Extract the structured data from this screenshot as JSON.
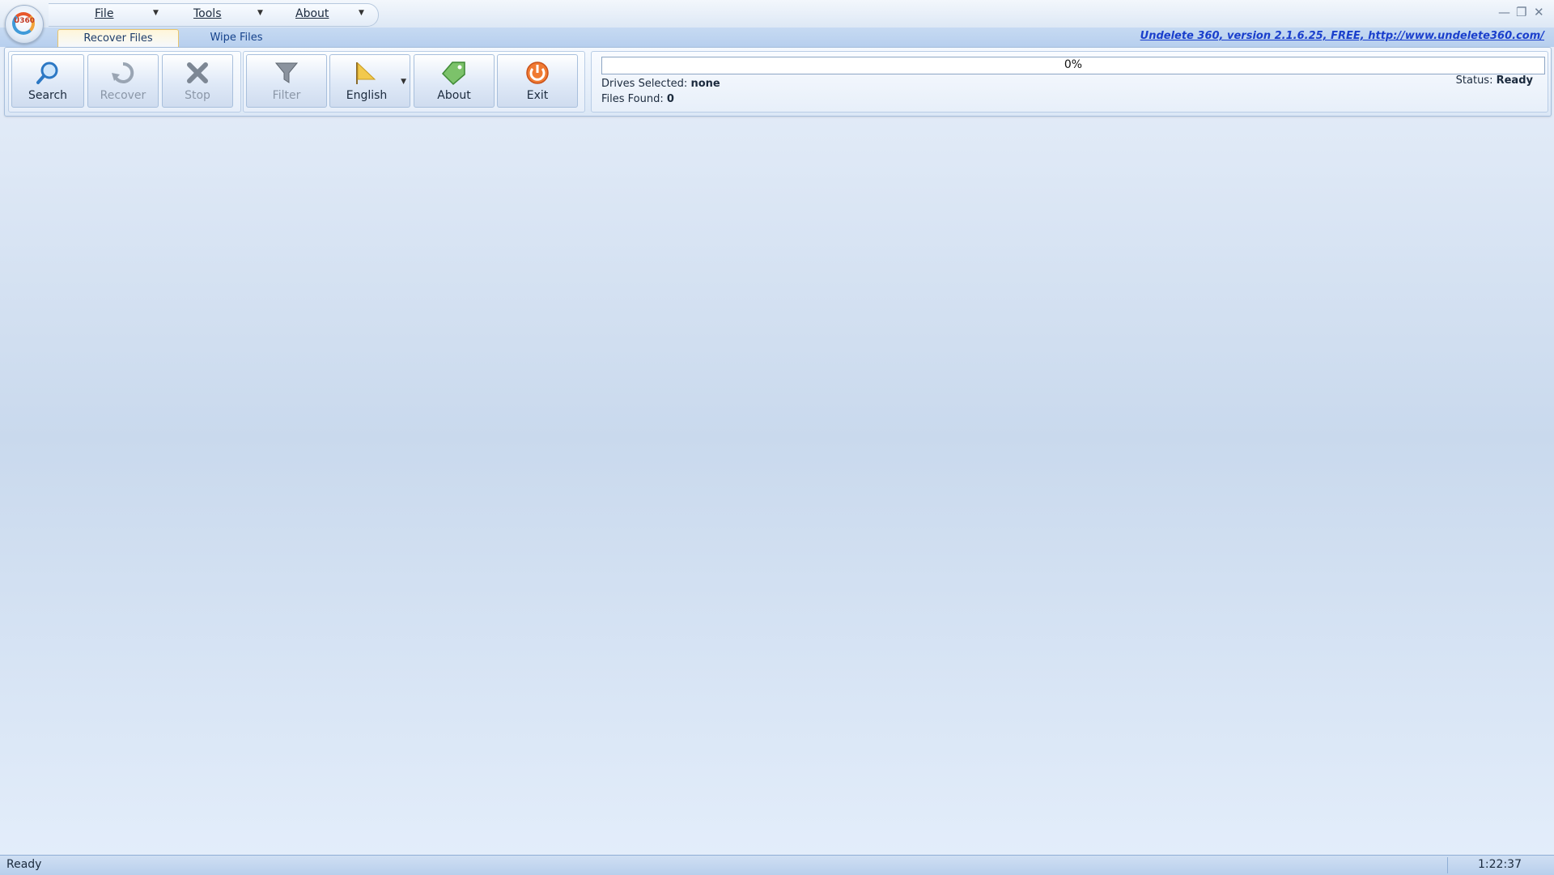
{
  "app": {
    "logo_text": "U360",
    "version_link": "Undelete 360, version 2.1.6.25, FREE, http://www.undelete360.com/"
  },
  "menu": {
    "file": "File",
    "tools": "Tools",
    "about": "About"
  },
  "tabs": [
    {
      "label": "Recover Files",
      "active": true
    },
    {
      "label": "Wipe Files",
      "active": false
    }
  ],
  "toolbar": {
    "search": "Search",
    "recover": "Recover",
    "stop": "Stop",
    "filter": "Filter",
    "language": "English",
    "about": "About",
    "exit": "Exit"
  },
  "progress": {
    "value": 0,
    "label": "0%"
  },
  "info": {
    "drives_label": "Drives Selected:",
    "drives_value": "none",
    "files_label": "Files Found:",
    "files_value": "0",
    "status_label": "Status:",
    "status_value": "Ready"
  },
  "statusbar": {
    "left": "Ready",
    "time": "1:22:37"
  },
  "icons": {
    "search": "magnifier-icon",
    "recover": "recover-arrow-icon",
    "stop": "x-icon",
    "filter": "funnel-icon",
    "language": "flag-icon",
    "about": "tag-icon",
    "exit": "power-icon"
  },
  "colors": {
    "accent": "#15428b",
    "link": "#1a3fcc",
    "ribbon_bg": "#dbe7f6"
  }
}
